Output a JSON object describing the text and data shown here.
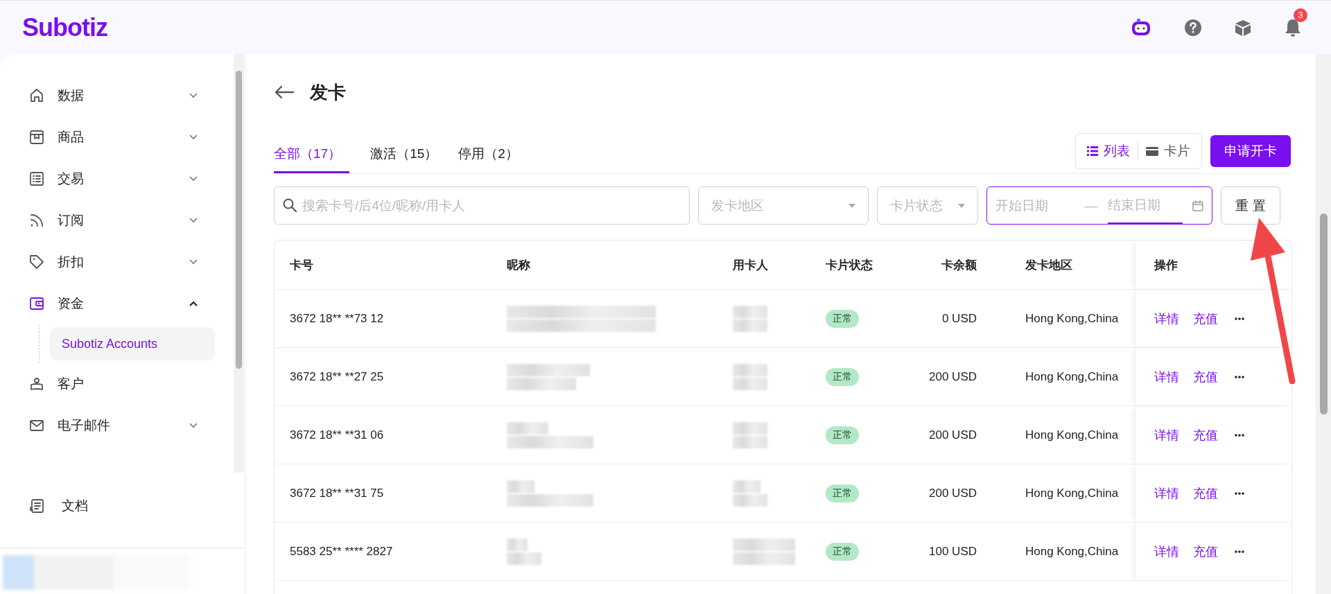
{
  "topbar": {
    "logo": "Subotiz",
    "notification_count": "3"
  },
  "sidebar": {
    "items": [
      {
        "label": "数据",
        "kind": "group",
        "expanded": false,
        "selected": false
      },
      {
        "label": "商品",
        "kind": "group",
        "expanded": false,
        "selected": false
      },
      {
        "label": "交易",
        "kind": "group",
        "expanded": false,
        "selected": false
      },
      {
        "label": "订阅",
        "kind": "group",
        "expanded": false,
        "selected": false
      },
      {
        "label": "折扣",
        "kind": "group",
        "expanded": false,
        "selected": false
      },
      {
        "label": "资金",
        "kind": "group",
        "expanded": true,
        "selected": true,
        "children": [
          {
            "label": "Subotiz Accounts",
            "selected": true
          }
        ]
      },
      {
        "label": "客户",
        "kind": "link",
        "selected": false
      },
      {
        "label": "电子邮件",
        "kind": "group",
        "expanded": false,
        "selected": false
      }
    ],
    "footer_item": "文档"
  },
  "page": {
    "title": "发卡",
    "tabs": [
      {
        "label": "全部（17）",
        "selected": true
      },
      {
        "label": "激活（15）",
        "selected": false
      },
      {
        "label": "停用（2）",
        "selected": false
      }
    ],
    "view_toggle": [
      {
        "label": "列表",
        "selected": true
      },
      {
        "label": "卡片",
        "selected": false
      }
    ],
    "primary_button": "申请开卡",
    "filters": {
      "search": {
        "placeholder": "搜索卡号/后4位/昵称/用卡人"
      },
      "region": {
        "placeholder": "发卡地区"
      },
      "status": {
        "placeholder": "卡片状态"
      },
      "date_range": {
        "start_placeholder": "开始日期",
        "separator": "—",
        "end_placeholder": "结束日期",
        "focused": true
      },
      "reset_button": "重 置"
    },
    "table": {
      "columns": [
        "卡号",
        "昵称",
        "用卡人",
        "卡片状态",
        "卡余额",
        "发卡地区",
        "操作"
      ],
      "rows": [
        {
          "card_number": "3672 18** **73 12",
          "status": "正常",
          "balance": "0 USD",
          "region": "Hong Kong,China",
          "actions": [
            "详情",
            "充值"
          ]
        },
        {
          "card_number": "3672 18** **27 25",
          "status": "正常",
          "balance": "200 USD",
          "region": "Hong Kong,China",
          "actions": [
            "详情",
            "充值"
          ]
        },
        {
          "card_number": "3672 18** **31 06",
          "status": "正常",
          "balance": "200 USD",
          "region": "Hong Kong,China",
          "actions": [
            "详情",
            "充值"
          ]
        },
        {
          "card_number": "3672 18** **31 75",
          "status": "正常",
          "balance": "200 USD",
          "region": "Hong Kong,China",
          "actions": [
            "详情",
            "充值"
          ]
        },
        {
          "card_number": "5583 25** **** 2827",
          "status": "正常",
          "balance": "100 USD",
          "region": "Hong Kong,China",
          "actions": [
            "详情",
            "充值"
          ]
        }
      ]
    }
  }
}
